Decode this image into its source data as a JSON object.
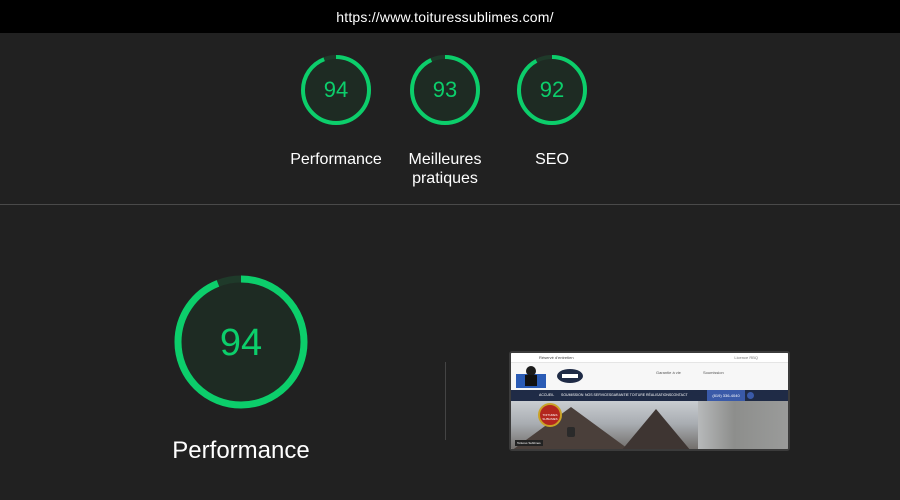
{
  "address_bar": {
    "url": "https://www.toituressublimes.com/"
  },
  "scores": [
    {
      "value": "94",
      "label": "Performance",
      "fraction": 0.94
    },
    {
      "value": "93",
      "label": "Meilleures pratiques",
      "fraction": 0.93
    },
    {
      "value": "92",
      "label": "SEO",
      "fraction": 0.92
    }
  ],
  "featured": {
    "value": "94",
    "label": "Performance",
    "fraction": 0.94
  },
  "colors": {
    "background": "#212121",
    "topbar": "#000000",
    "pass_green": "#0cce6b",
    "gauge_fill": "#1e2b23"
  },
  "thumbnail": {
    "top_left": "Réservé d'entretien",
    "top_right": "Licence RBQ",
    "header_item_1": "Garantie à vie",
    "header_item_2": "Soumission",
    "nav": [
      "ACCUEIL",
      "SOUMISSION",
      "NOS SERVICES",
      "GARANTIE TOITURE",
      "RÉALISATIONS",
      "CONTACT"
    ],
    "phone": "(819) 336-4040",
    "badge_text": "TOITURES SUBLIMES",
    "caption": "Toitures Sublimes"
  }
}
